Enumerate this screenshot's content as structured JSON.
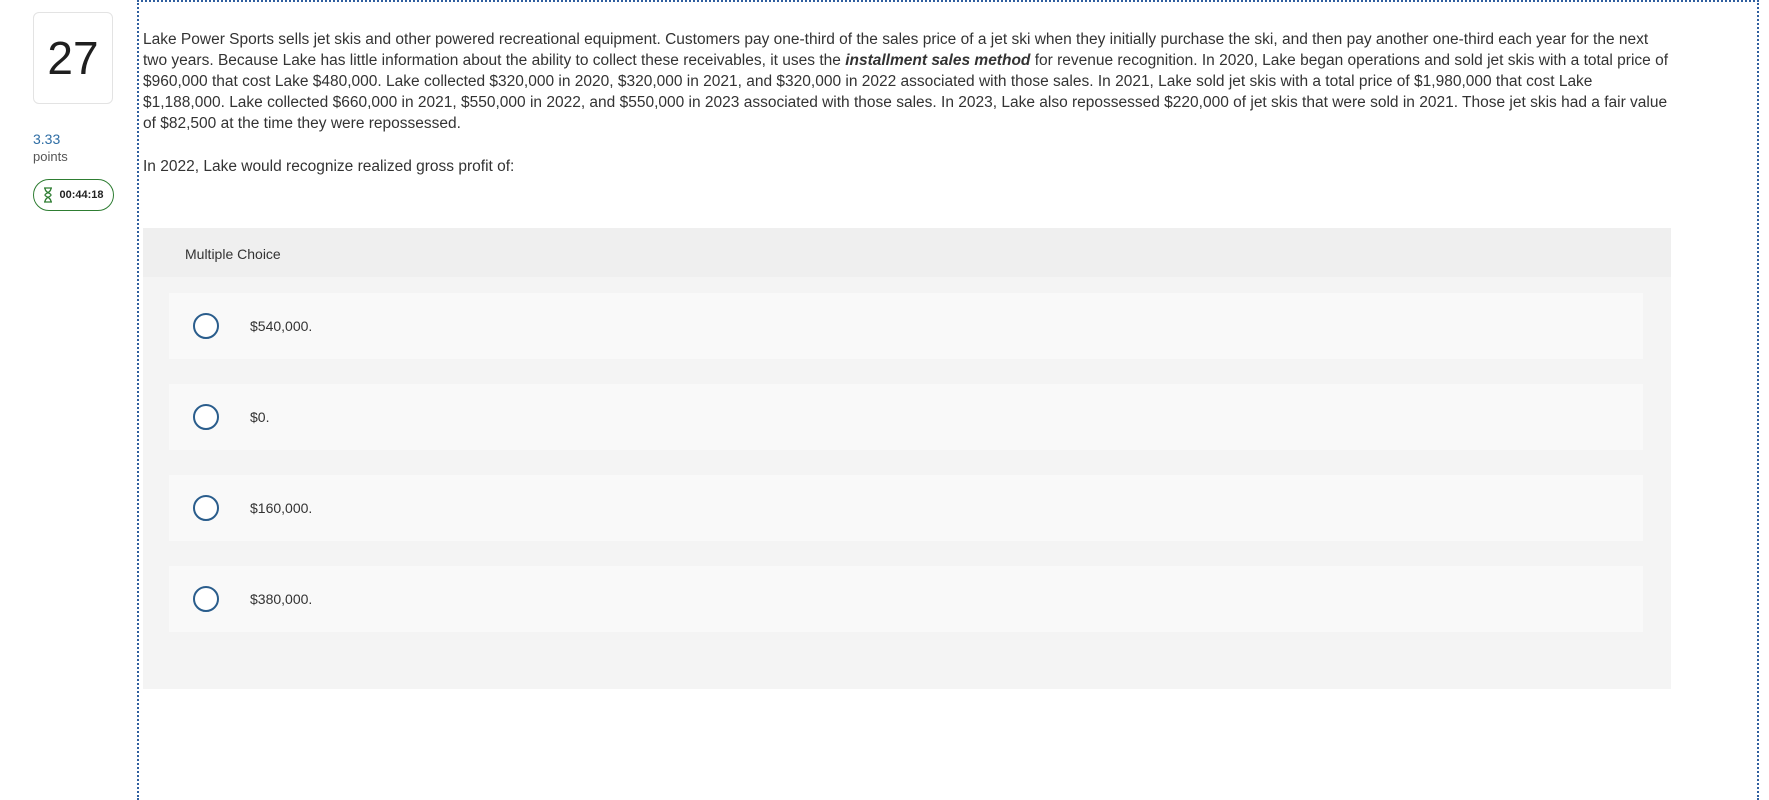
{
  "question": {
    "number": "27",
    "points_value": "3.33",
    "points_label": "points",
    "timer": "00:44:18",
    "text_before": "Lake Power Sports sells jet skis and other powered recreational equipment. Customers pay one-third of the sales price of a jet ski when they initially purchase the ski, and then pay another one-third each year for the next two years. Because Lake has little information about the ability to collect these receivables, it uses the ",
    "text_emphasis": "installment sales method",
    "text_after": " for revenue recognition. In 2020, Lake began operations and sold jet skis with a total price of $960,000 that cost Lake $480,000. Lake collected $320,000 in 2020, $320,000 in 2021, and $320,000 in 2022 associated with those sales. In 2021, Lake sold jet skis with a total price of $1,980,000 that cost Lake $1,188,000. Lake collected $660,000 in 2021, $550,000 in 2022, and $550,000 in 2023 associated with those sales. In 2023, Lake also repossessed $220,000 of jet skis that were sold in 2021. Those jet skis had a fair value of $82,500 at the time they were repossessed.",
    "prompt": "In 2022, Lake would recognize realized gross profit of:"
  },
  "multiple_choice": {
    "title": "Multiple Choice",
    "choices": [
      {
        "label": "$540,000."
      },
      {
        "label": "$0."
      },
      {
        "label": "$160,000."
      },
      {
        "label": "$380,000."
      }
    ]
  },
  "colors": {
    "accent_blue": "#2a5d8c",
    "timer_green": "#2e7d32",
    "panel_bg": "#f4f4f4"
  },
  "icons": {
    "timer": "hourglass-icon",
    "choice": "radio-button-icon"
  }
}
